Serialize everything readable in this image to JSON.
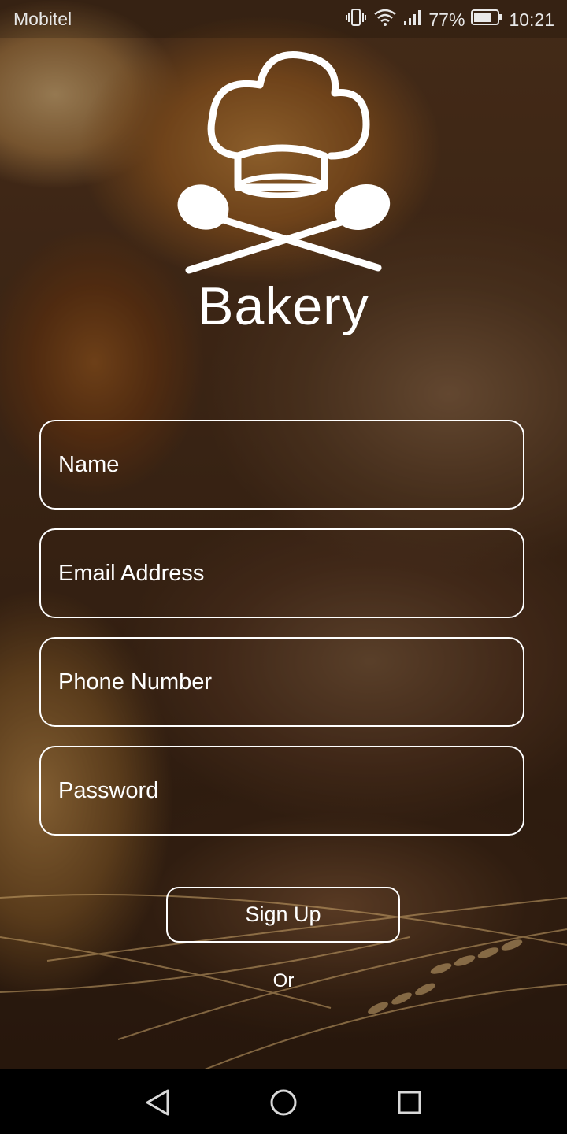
{
  "status_bar": {
    "carrier": "Mobitel",
    "battery_percent": "77%",
    "time": "10:21",
    "icons": [
      "vibrate-icon",
      "wifi-icon",
      "signal-icon",
      "battery-icon"
    ]
  },
  "app": {
    "brand_name": "Bakery",
    "logo_icon": "chef-hat-crossed-spoons-icon"
  },
  "form": {
    "name_placeholder": "Name",
    "email_placeholder": "Email Address",
    "phone_placeholder": "Phone Number",
    "password_placeholder": "Password",
    "signup_label": "Sign Up",
    "or_label": "Or"
  },
  "nav_bar": {
    "icons": [
      "back-icon",
      "home-icon",
      "recent-apps-icon"
    ]
  },
  "colors": {
    "text": "#ffffff",
    "nav_bar": "#000000"
  }
}
